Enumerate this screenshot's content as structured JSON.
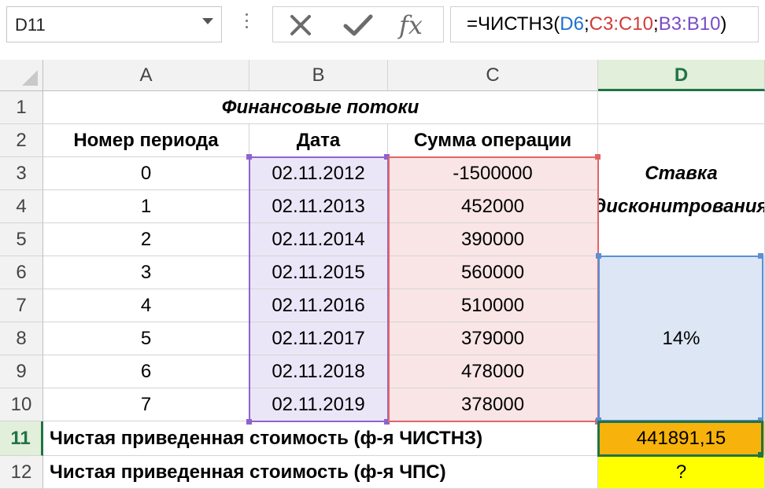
{
  "formula_bar": {
    "name_box": "D11",
    "formula_prefix": "=ЧИСТНЗ(",
    "arg1": "D6",
    "sep1": ";",
    "arg2": "C3:C10",
    "sep2": ";",
    "arg3": "B3:B10",
    "formula_suffix": ")",
    "fx_label": "fx"
  },
  "columns": [
    "A",
    "B",
    "C",
    "D"
  ],
  "selected_column": "D",
  "rows": [
    "1",
    "2",
    "3",
    "4",
    "5",
    "6",
    "7",
    "8",
    "9",
    "10",
    "11",
    "12"
  ],
  "selected_row": "11",
  "sheet": {
    "title": "Финансовые потоки",
    "headers": {
      "period": "Номер периода",
      "date": "Дата",
      "amount": "Сумма операции"
    },
    "rate_label": "Ставка дисконитрования",
    "rate_value": "14%",
    "data": [
      {
        "period": "0",
        "date": "02.11.2012",
        "amount": "-1500000"
      },
      {
        "period": "1",
        "date": "02.11.2013",
        "amount": "452000"
      },
      {
        "period": "2",
        "date": "02.11.2014",
        "amount": "390000"
      },
      {
        "period": "3",
        "date": "02.11.2015",
        "amount": "560000"
      },
      {
        "period": "4",
        "date": "02.11.2016",
        "amount": "510000"
      },
      {
        "period": "5",
        "date": "02.11.2017",
        "amount": "379000"
      },
      {
        "period": "6",
        "date": "02.11.2018",
        "amount": "478000"
      },
      {
        "period": "7",
        "date": "02.11.2019",
        "amount": "378000"
      }
    ],
    "npv_xnpv_label": "Чистая приведенная стоимость (ф-я ЧИСТНЗ)",
    "npv_xnpv_value": "441891,15",
    "npv_label": "Чистая приведенная стоимость (ф-я ЧПС)",
    "npv_value": "?"
  },
  "colors": {
    "selection_green": "#217346",
    "date_range": "#8e63ce",
    "amount_range": "#e06666",
    "rate_range": "#5b8fd8",
    "result_fill": "#f7b20b",
    "question_fill": "#ffff00"
  }
}
